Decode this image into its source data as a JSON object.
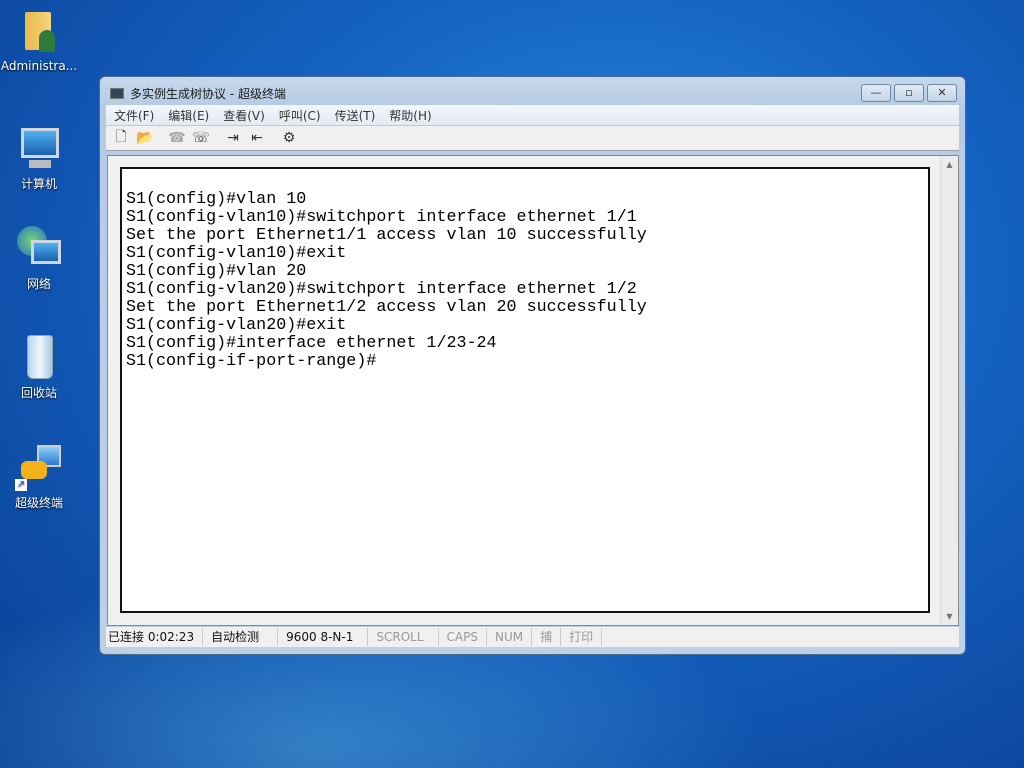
{
  "desktop": {
    "icons": [
      {
        "label": "Administra...",
        "icon": "user-folder-icon"
      },
      {
        "label": "计算机",
        "icon": "computer-icon"
      },
      {
        "label": "网络",
        "icon": "network-icon"
      },
      {
        "label": "回收站",
        "icon": "recycle-bin-icon"
      },
      {
        "label": "超级终端",
        "icon": "hyperterminal-shortcut-icon"
      }
    ]
  },
  "window": {
    "title": "多实例生成树协议 - 超级终端",
    "controls": {
      "minimize": "—",
      "maximize": "▫",
      "close": "✕"
    },
    "menu": [
      "文件(F)",
      "编辑(E)",
      "查看(V)",
      "呼叫(C)",
      "传送(T)",
      "帮助(H)"
    ],
    "toolbar": {
      "new": "🗋",
      "open": "📂",
      "disconnect": "☎",
      "call": "☏",
      "send": "⇥",
      "receive": "⇤",
      "properties": "⚙"
    },
    "terminal_lines": [
      "S1(config)#vlan 10",
      "S1(config-vlan10)#switchport interface ethernet 1/1",
      "Set the port Ethernet1/1 access vlan 10 successfully",
      "S1(config-vlan10)#exit",
      "S1(config)#vlan 20",
      "S1(config-vlan20)#switchport interface ethernet 1/2",
      "Set the port Ethernet1/2 access vlan 20 successfully",
      "S1(config-vlan20)#exit",
      "S1(config)#interface ethernet 1/23-24",
      "S1(config-if-port-range)#"
    ],
    "status": {
      "connected": "已连接 0:02:23",
      "detect": "自动检测",
      "baud": "9600 8-N-1",
      "scroll": "SCROLL",
      "caps": "CAPS",
      "num": "NUM",
      "capture": "捕",
      "print": "打印"
    }
  }
}
